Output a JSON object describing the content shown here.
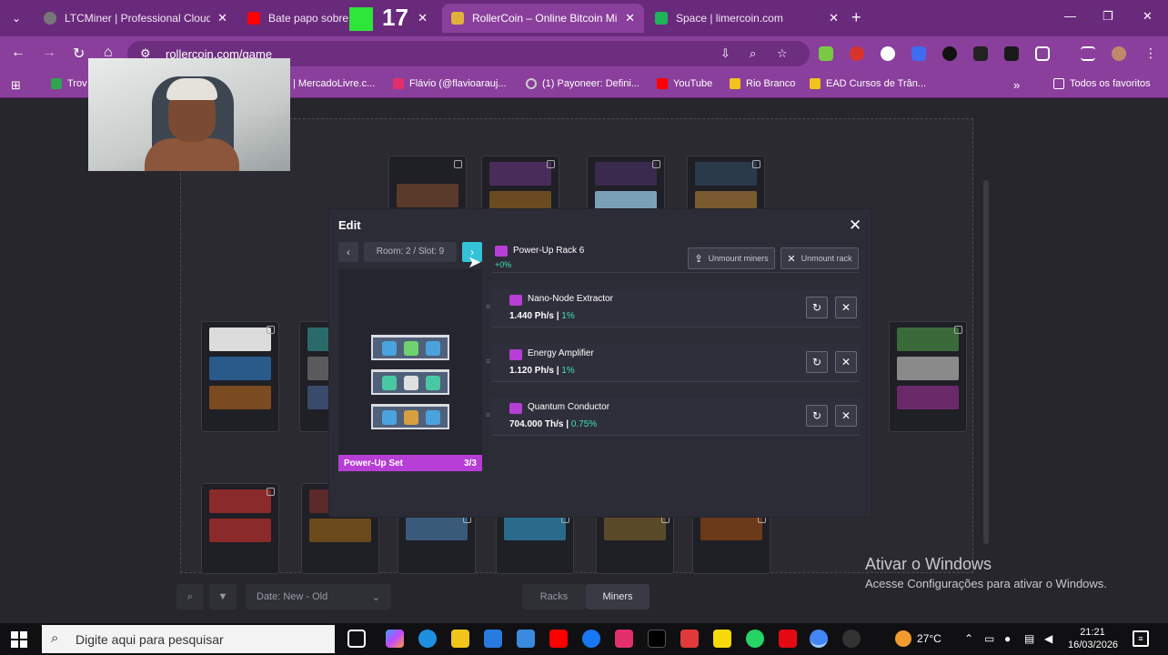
{
  "browser": {
    "tabs": [
      {
        "title": "LTCMiner | Professional Cloud M",
        "active": false
      },
      {
        "title": "Bate papo sobre cr",
        "active": false
      },
      {
        "title": "RollerCoin – Online Bitcoin Min",
        "active": true
      },
      {
        "title": "Space | limercoin.com",
        "active": false
      }
    ],
    "overlay_counter": "17",
    "url": "rollercoin.com/game",
    "bookmarks": [
      {
        "label": "Trov"
      },
      {
        "label": "| MercadoLivre.c..."
      },
      {
        "label": "Flávio (@flavioarauj..."
      },
      {
        "label": "(1) Payoneer: Defini..."
      },
      {
        "label": "YouTube"
      },
      {
        "label": "Rio Branco"
      },
      {
        "label": "EAD Cursos de Trân..."
      }
    ],
    "bookmarks_more": "»",
    "all_bookmarks": "Todos os favoritos"
  },
  "game": {
    "bottom": {
      "sort_label": "Date: New - Old",
      "tab_racks": "Racks",
      "tab_miners": "Miners"
    }
  },
  "modal": {
    "title": "Edit",
    "slot_label": "Room: 2 / Slot: 9",
    "rack_name": "Power-Up Rack 6",
    "rack_bonus": "+0%",
    "unmount_miners": "Unmount miners",
    "unmount_rack": "Unmount rack",
    "set_label": "Power-Up Set",
    "set_count": "3/3",
    "miners": [
      {
        "name": "Nano-Node Extractor",
        "power": "1.440 Ph/s",
        "bonus": "1%"
      },
      {
        "name": "Energy Amplifier",
        "power": "1.120 Ph/s",
        "bonus": "1%"
      },
      {
        "name": "Quantum Conductor",
        "power": "704.000 Th/s",
        "bonus": "0.75%"
      }
    ]
  },
  "windows": {
    "watermark_title": "Ativar o Windows",
    "watermark_sub": "Acesse Configurações para ativar o Windows.",
    "search_placeholder": "Digite aqui para pesquisar",
    "temperature": "27°C",
    "time": "21:21",
    "date": "16/03/2026"
  }
}
